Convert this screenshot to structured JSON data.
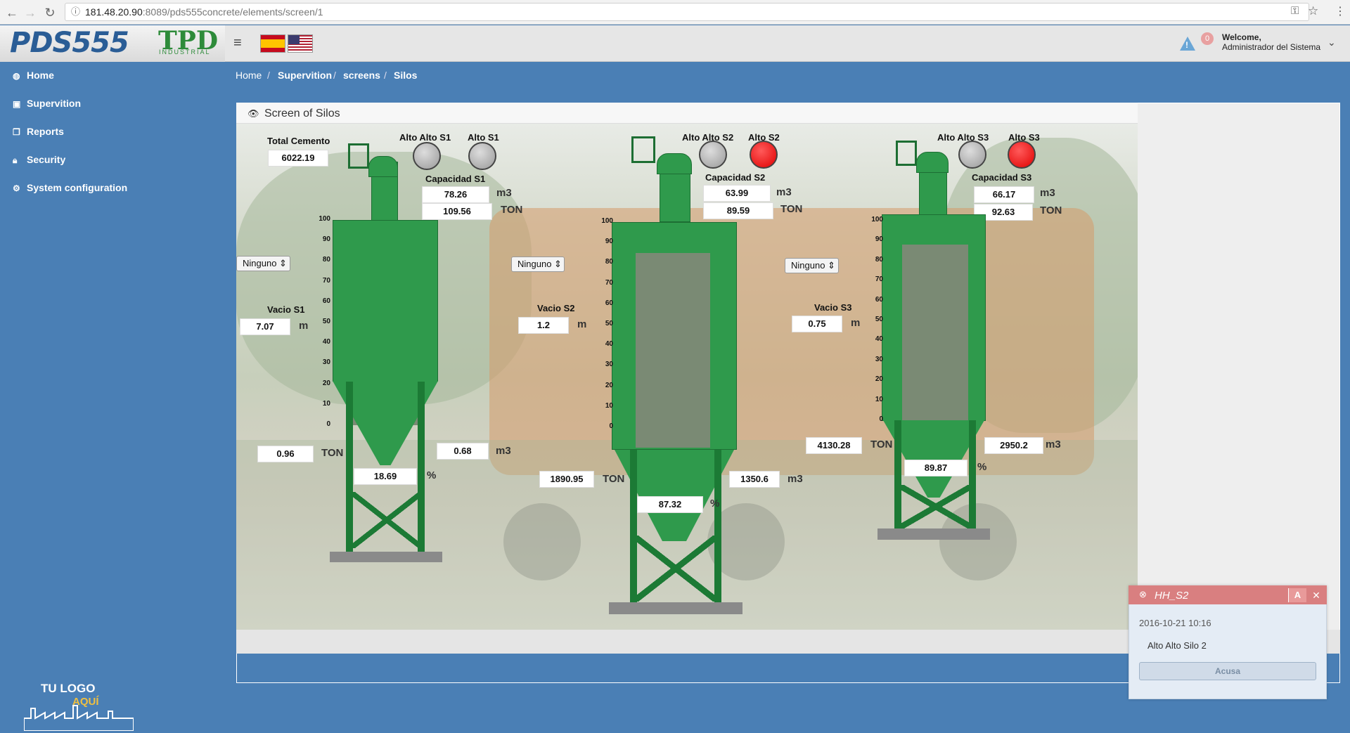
{
  "browser": {
    "url_host": "181.48.20.90",
    "url_path": ":8089/pds555concrete/elements/screen/1"
  },
  "header": {
    "logo_left": "PDS555",
    "logo_right": "TPD",
    "logo_right_sub": "INDUSTRIAL",
    "alert_count": "0",
    "welcome": "Welcome,",
    "user": "Administrador del Sistema"
  },
  "sidebar": {
    "items": [
      {
        "label": "Home",
        "icon": "dashboard-icon"
      },
      {
        "label": "Supervition",
        "icon": "play-square-icon"
      },
      {
        "label": "Reports",
        "icon": "clipboard-icon"
      },
      {
        "label": "Security",
        "icon": "lock-icon"
      },
      {
        "label": "System configuration",
        "icon": "gear-icon"
      }
    ],
    "footer_logo_line1": "TU LOGO",
    "footer_logo_line2": "AQUÍ"
  },
  "breadcrumb": [
    "Home",
    "Supervition",
    "screens",
    "Silos"
  ],
  "panel": {
    "title": "Screen of Silos",
    "total_label": "Total Cemento",
    "total_value": "6022.19",
    "scale_ticks": [
      "100",
      "90",
      "80",
      "70",
      "60",
      "50",
      "40",
      "30",
      "20",
      "10",
      "0"
    ],
    "silos": [
      {
        "hh_label": "Alto Alto S1",
        "h_label": "Alto S1",
        "hh_state": "off",
        "h_state": "off",
        "cap_label": "Capacidad S1",
        "cap_m3": "78.26",
        "cap_ton": "109.56",
        "unit_m3": "m3",
        "unit_ton": "TON",
        "select": "Ninguno",
        "vacio_label": "Vacio S1",
        "vacio_value": "7.07",
        "vacio_unit": "m",
        "ton_value": "0.96",
        "m3_value": "0.68",
        "pct_value": "18.69",
        "pct_unit": "%",
        "fill_level": 0.19
      },
      {
        "hh_label": "Alto Alto S2",
        "h_label": "Alto S2",
        "hh_state": "off",
        "h_state": "on",
        "cap_label": "Capacidad S2",
        "cap_m3": "63.99",
        "cap_ton": "89.59",
        "unit_m3": "m3",
        "unit_ton": "TON",
        "select": "Ninguno",
        "vacio_label": "Vacio S2",
        "vacio_value": "1.2",
        "vacio_unit": "m",
        "ton_value": "1890.95",
        "m3_value": "1350.6",
        "pct_value": "87.32",
        "pct_unit": "%",
        "fill_level": 0.87
      },
      {
        "hh_label": "Alto Alto S3",
        "h_label": "Alto S3",
        "hh_state": "off",
        "h_state": "on",
        "cap_label": "Capacidad S3",
        "cap_m3": "66.17",
        "cap_ton": "92.63",
        "unit_m3": "m3",
        "unit_ton": "TON",
        "select": "Ninguno",
        "vacio_label": "Vacio S3",
        "vacio_value": "0.75",
        "vacio_unit": "m",
        "ton_value": "4130.28",
        "m3_value": "2950.2",
        "pct_value": "89.87",
        "pct_unit": "%",
        "fill_level": 0.9
      }
    ]
  },
  "notification": {
    "title": "HH_S2",
    "ack_letter": "A",
    "date": "2016-10-21 10:16",
    "message": "Alto Alto Silo 2",
    "button": "Acusa"
  },
  "colors": {
    "sidebar": "#4a7fb5",
    "silo_green": "#2f9a4c",
    "alarm_red": "#e00000",
    "notif_header": "#d97f80"
  }
}
